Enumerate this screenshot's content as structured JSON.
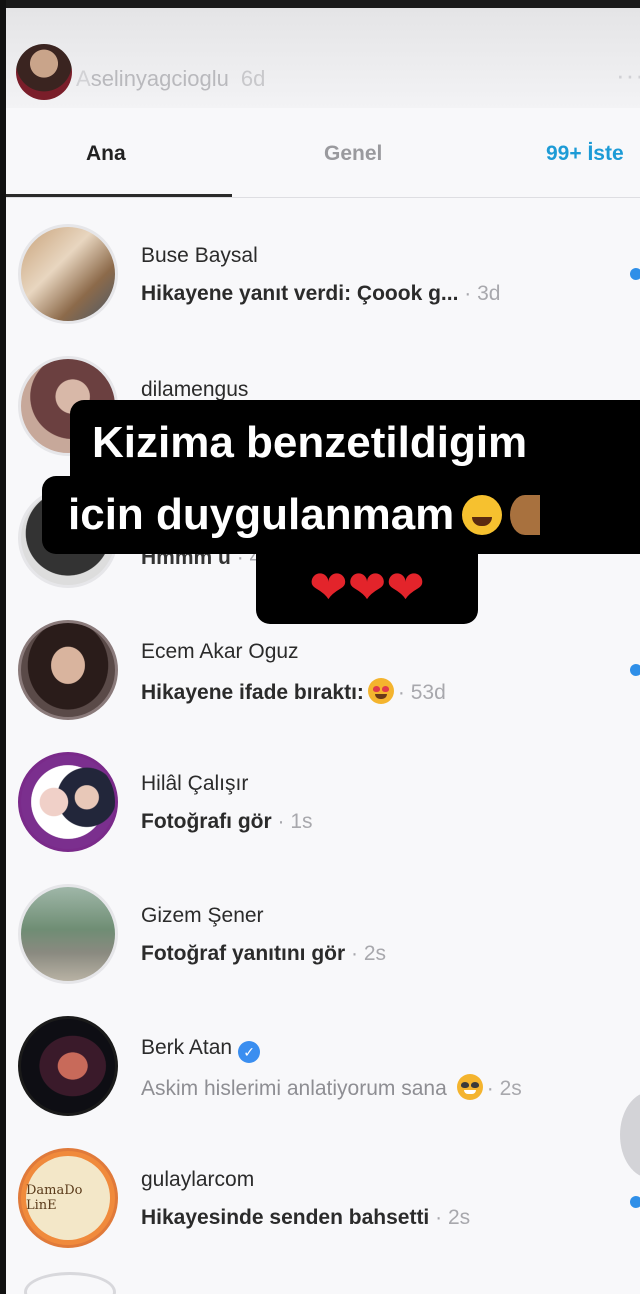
{
  "story": {
    "username_prefix": "A",
    "username": "selinyagcioglu",
    "time": "6d",
    "more": "···"
  },
  "tabs": [
    {
      "label": "Ana"
    },
    {
      "label": "Genel"
    },
    {
      "label": "99+ İste"
    }
  ],
  "notifications": [
    {
      "name": "Buse Baysal",
      "text": "Hikayene yanıt verdi: Çoook g...",
      "time": "· 3d",
      "unread": true
    },
    {
      "name": "dilamengus",
      "text": "",
      "time": "",
      "unread": false
    },
    {
      "name": "",
      "text": "Hmmm u",
      "time": "· 4d",
      "unread": false
    },
    {
      "name": "Ecem Akar Oguz",
      "text": "Hikayene ifade bıraktı:",
      "time": "· 53d",
      "unread": true
    },
    {
      "name": "Hilâl Çalışır",
      "text": "Fotoğrafı gör",
      "time": "· 1s",
      "unread": false
    },
    {
      "name": "Gizem Şener",
      "text": "Fotoğraf yanıtını gör",
      "time": "· 2s",
      "unread": false
    },
    {
      "name": "Berk Atan",
      "text": "Askim hislerimi anlatiyorum sana",
      "time": "· 2s",
      "unread": false
    },
    {
      "name": "gulaylarcom",
      "text": "Hikayesinde senden bahsetti",
      "time": "· 2s",
      "unread": true
    }
  ],
  "overlay": {
    "line1": "Kizima benzetildigim",
    "line2": "icin duygulanmam",
    "hearts": "❤❤❤"
  },
  "avatar_label_gulaylar": "DamaDo LinE"
}
